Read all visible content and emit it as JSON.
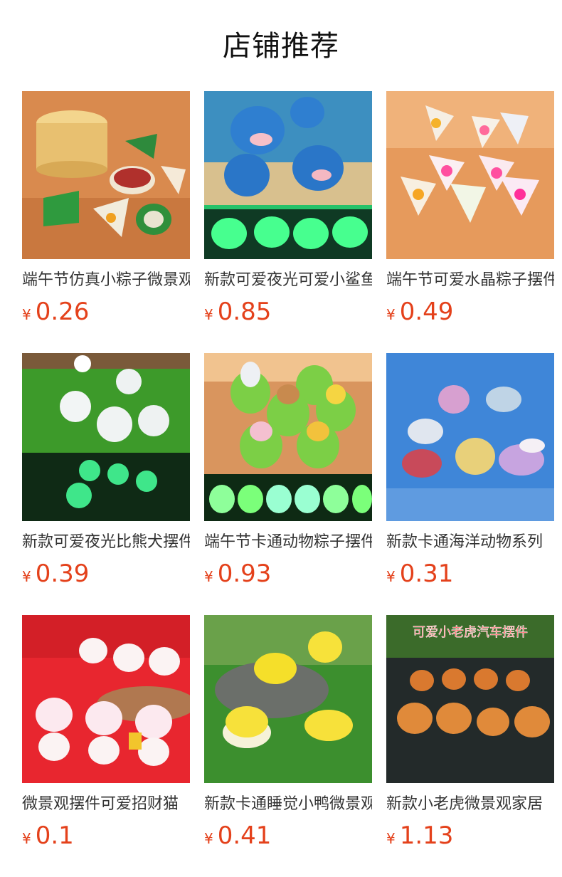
{
  "section": {
    "title": "店铺推荐"
  },
  "products": [
    {
      "name": "端午节仿真小粽子微景观",
      "currency": "¥",
      "price": "0.26",
      "image_theme": "rice-dumplings-resin"
    },
    {
      "name": "新款可爱夜光可爱小鲨鱼",
      "currency": "¥",
      "price": "0.85",
      "image_theme": "glow-sharks"
    },
    {
      "name": "端午节可爱水晶粽子摆件",
      "currency": "¥",
      "price": "0.49",
      "image_theme": "crystal-dumplings"
    },
    {
      "name": "新款可爱夜光比熊犬摆件",
      "currency": "¥",
      "price": "0.39",
      "image_theme": "glow-bichon-dogs"
    },
    {
      "name": "端午节卡通动物粽子摆件",
      "currency": "¥",
      "price": "0.93",
      "image_theme": "animal-dumplings"
    },
    {
      "name": "新款卡通海洋动物系列",
      "currency": "¥",
      "price": "0.31",
      "image_theme": "ocean-animals"
    },
    {
      "name": "微景观摆件可爱招财猫",
      "currency": "¥",
      "price": "0.1",
      "image_theme": "lucky-cats"
    },
    {
      "name": "新款卡通睡觉小鸭微景观",
      "currency": "¥",
      "price": "0.41",
      "image_theme": "sleeping-ducks"
    },
    {
      "name": "新款小老虎微景观家居",
      "currency": "¥",
      "price": "1.13",
      "image_theme": "tigers-car",
      "image_caption": "可爱小老虎汽车摆件"
    }
  ],
  "colors": {
    "price": "#e4411b",
    "text": "#333333",
    "title": "#111111"
  }
}
